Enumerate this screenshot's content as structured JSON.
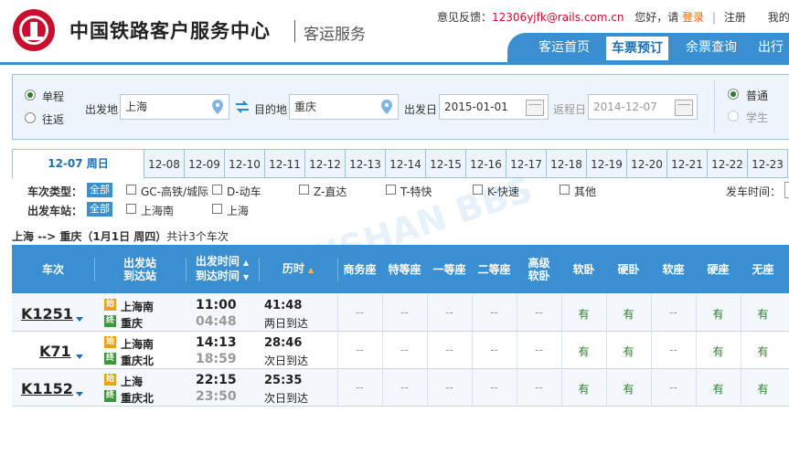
{
  "header": {
    "site_title": "中国铁路客户服务中心",
    "site_subtitle": "客运服务",
    "feedback_label": "意见反馈：",
    "feedback_email": "12306yjfk@rails.com.cn",
    "greeting": "您好，请",
    "login": "登录",
    "separator": "|",
    "register": "注册",
    "overflow": "我的"
  },
  "nav": {
    "items": [
      {
        "label": "客运首页"
      },
      {
        "label": "车票预订"
      },
      {
        "label": "余票查询"
      },
      {
        "label": "出行"
      }
    ],
    "active": "车票预订"
  },
  "search": {
    "trip_single": "单程",
    "trip_round": "往返",
    "from_label": "出发地",
    "from_value": "上海",
    "to_label": "目的地",
    "to_value": "重庆",
    "depart_label": "出发日",
    "depart_value": "2015-01-01",
    "return_label": "返程日",
    "return_value": "2014-12-07",
    "ticket_normal": "普通",
    "ticket_student": "学生"
  },
  "dates": {
    "first": "12-07 周日",
    "tabs": [
      "12-08",
      "12-09",
      "12-10",
      "12-11",
      "12-12",
      "12-13",
      "12-14",
      "12-15",
      "12-16",
      "12-17",
      "12-18",
      "12-19",
      "12-20",
      "12-21",
      "12-22",
      "12-23"
    ]
  },
  "filters": {
    "type_label": "车次类型：",
    "all": "全部",
    "types": [
      "GC-高铁/城际",
      "D-动车",
      "Z-直达",
      "T-特快",
      "K-快速",
      "其他"
    ],
    "depart_time_label": "发车时间：",
    "station_label": "出发车站：",
    "stations": [
      "上海南",
      "上海"
    ]
  },
  "summary": {
    "route": "上海 --> 重庆（1月1日 周四）",
    "count_text": "共计3个车次"
  },
  "table": {
    "h_train": "车次",
    "h_station_1": "出发站",
    "h_station_2": "到达站",
    "h_time_1": "出发时间",
    "h_time_2": "到达时间",
    "h_duration": "历时",
    "seat_headers": [
      "商务座",
      "特等座",
      "一等座",
      "二等座",
      "高级软卧",
      "软卧",
      "硬卧",
      "软座",
      "硬座",
      "无座"
    ],
    "start_badge": "始",
    "end_badge": "终",
    "rows": [
      {
        "train": "K1251",
        "from": "上海南",
        "to": "重庆",
        "dep": "11:00",
        "arr": "04:48",
        "duration": "41:48",
        "arrive": "两日到达",
        "seats": [
          "--",
          "--",
          "--",
          "--",
          "--",
          "有",
          "有",
          "--",
          "有",
          "有"
        ]
      },
      {
        "train": "K71",
        "from": "上海南",
        "to": "重庆北",
        "dep": "14:13",
        "arr": "18:59",
        "duration": "28:46",
        "arrive": "次日到达",
        "seats": [
          "--",
          "--",
          "--",
          "--",
          "--",
          "有",
          "有",
          "--",
          "有",
          "有"
        ]
      },
      {
        "train": "K1152",
        "from": "上海",
        "to": "重庆北",
        "dep": "22:15",
        "arr": "23:50",
        "duration": "25:35",
        "arrive": "次日到达",
        "seats": [
          "--",
          "--",
          "--",
          "--",
          "--",
          "有",
          "有",
          "--",
          "有",
          "有"
        ]
      }
    ]
  },
  "colors": {
    "brand_blue": "#3a8fd1",
    "brand_red": "#c8102e",
    "available_green": "#2d7d2d",
    "login_orange": "#ff6600"
  }
}
